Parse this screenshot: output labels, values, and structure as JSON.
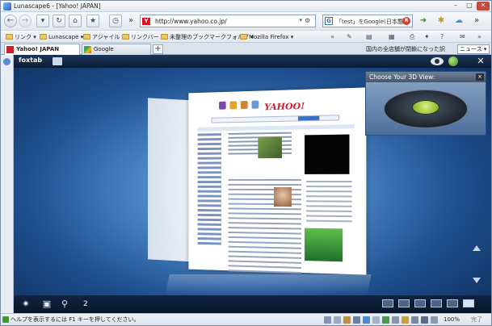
{
  "window": {
    "title": "Lunascape6 - [Yahoo! JAPAN]"
  },
  "nav": {
    "url": "http://www.yahoo.co.jp/",
    "search_text": "「test」をGoogle(日本語)",
    "search_engine_letter": "G",
    "stop_label": "R"
  },
  "bookmarks": [
    {
      "label": "リンク"
    },
    {
      "label": "Lunascape"
    },
    {
      "label": "アジャイル"
    },
    {
      "label": "リンクバー"
    },
    {
      "label": "未整理のブックマークフォルダ"
    },
    {
      "label": "Mozilla Firefox"
    }
  ],
  "tabs": [
    {
      "label": "Yahoo!  JAPAN",
      "active": true
    },
    {
      "label": "Google",
      "active": false
    }
  ],
  "ticker": {
    "text": "国内の全店舗が閉鎖になった訳",
    "button": "ニュース"
  },
  "foxtab": {
    "logo": "foxtab",
    "page_count": "2",
    "view_panel_title": "Choose Your 3D View:",
    "preview_logo": "YAHOO!"
  },
  "status": {
    "message": "ヘルプを表示するには F1 キーを押してください。",
    "zoom": "100%",
    "done": "完了"
  },
  "colors": {
    "accent": "#3c6fc4",
    "yahoo_red": "#d01c2b",
    "foxtab_bg": "#1e4f8f",
    "close_red": "#c9473b"
  },
  "icons": [
    "back-icon",
    "forward-icon",
    "reload-icon",
    "home-icon",
    "star-icon",
    "history-icon",
    "gear-icon",
    "search-icon",
    "briefcase-icon",
    "eye-icon",
    "globe-icon"
  ]
}
